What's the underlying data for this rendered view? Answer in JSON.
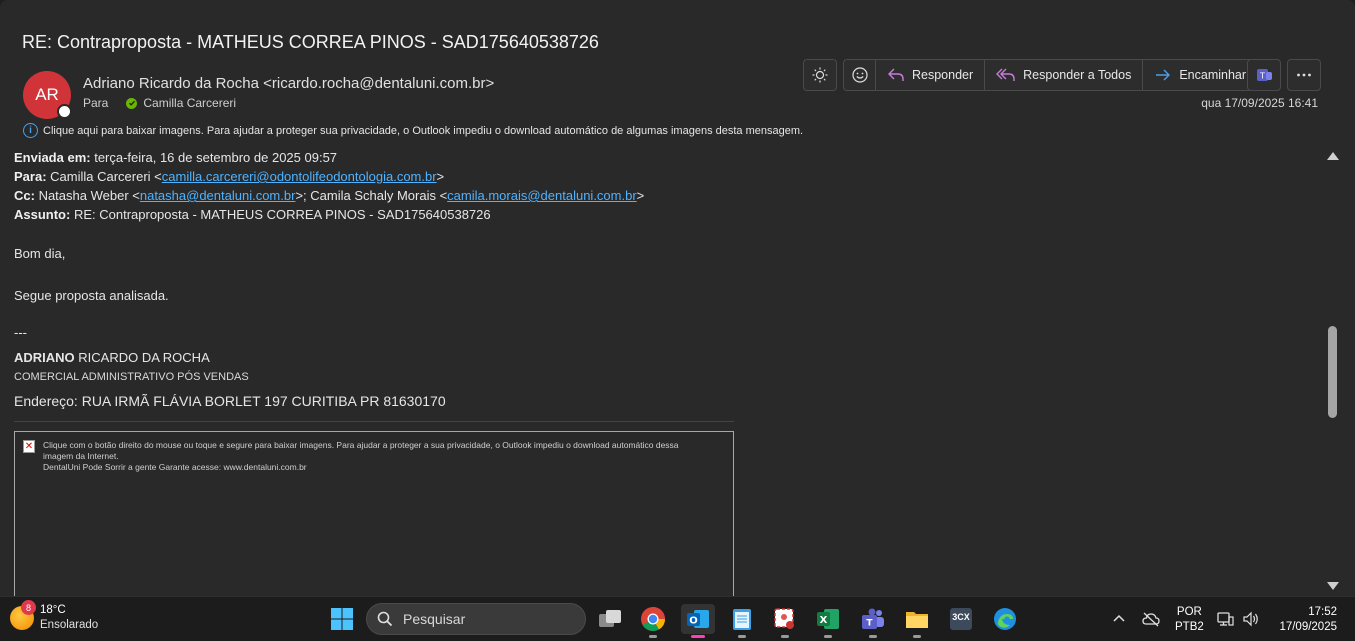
{
  "email": {
    "subject": "RE: Contraproposta - MATHEUS CORREA PINOS - SAD175640538726",
    "avatar_initials": "AR",
    "sender": "Adriano Ricardo da Rocha <ricardo.rocha@dentaluni.com.br>",
    "to_label": "Para",
    "to_name": "Camilla Carcereri",
    "date": "qua 17/09/2025 16:41",
    "info_banner": "Clique aqui para baixar imagens. Para ajudar a proteger sua privacidade, o Outlook impediu o download automático de algumas imagens desta mensagem."
  },
  "toolbar": {
    "reply": "Responder",
    "reply_all": "Responder a Todos",
    "forward": "Encaminhar"
  },
  "body": {
    "sent_label": "Enviada em:",
    "sent_value": " terça-feira, 16 de setembro de 2025 09:57",
    "to_label": "Para:",
    "to_name": " Camilla Carcereri <",
    "to_email": "camilla.carcereri@odontolifeodontologia.com.br",
    "to_close": ">",
    "cc_label": "Cc:",
    "cc_name1": " Natasha Weber <",
    "cc_email1": "natasha@dentaluni.com.br",
    "cc_name2": ">; Camila Schaly Morais <",
    "cc_email2": "camila.morais@dentaluni.com.br",
    "cc_close": ">",
    "subject_label": "Assunto:",
    "subject_value": " RE: Contraproposta - MATHEUS CORREA PINOS - SAD175640538726",
    "greeting": "Bom dia,",
    "text": "Segue proposta analisada.",
    "sig_dashes": "---",
    "sig_first": "ADRIANO",
    "sig_rest": " RICARDO DA ROCHA",
    "sig_role": "COMERCIAL ADMINISTRATIVO PÓS VENDAS",
    "sig_address": "Endereço: RUA IRMÃ FLÁVIA BORLET 197 CURITIBA PR 81630170",
    "blocked_image_text": "Clique com o botão direito do mouse ou toque e segure para baixar imagens. Para ajudar a proteger a sua privacidade, o Outlook impediu o download automático dessa imagem da Internet.",
    "blocked_image_alt": "DentalUni Pode Sorrir a gente Garante acesse: www.dentaluni.com.br"
  },
  "taskbar": {
    "temperature": "18°C",
    "condition": "Ensolarado",
    "weather_badge": "8",
    "search_placeholder": "Pesquisar",
    "lang_top": "POR",
    "lang_bottom": "PTB2",
    "time": "17:52",
    "date": "17/09/2025",
    "threecx_label": "3CX"
  },
  "colors": {
    "avatar": "#d13438",
    "link": "#4fb3ff",
    "accent": "#4ba0e8"
  }
}
